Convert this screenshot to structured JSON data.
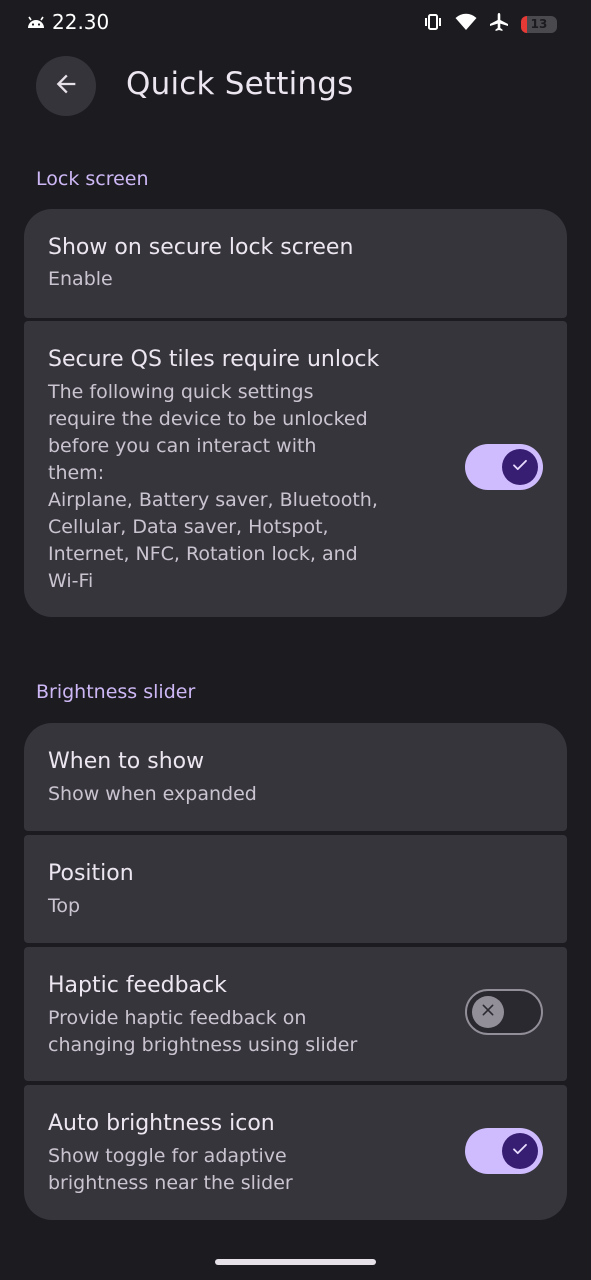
{
  "status_bar": {
    "time": "22.30",
    "battery_level": "13",
    "icons": [
      "android-icon",
      "vibrate-icon",
      "wifi-icon",
      "airplane-icon",
      "battery-icon"
    ]
  },
  "header": {
    "title": "Quick Settings",
    "back_icon": "arrow-back-icon"
  },
  "sections": {
    "lock_screen": {
      "label": "Lock screen",
      "items": [
        {
          "title": "Show on secure lock screen",
          "subtitle": "Enable"
        },
        {
          "title": "Secure QS tiles require unlock",
          "subtitle_lines": [
            "The following quick settings",
            "require the device to be unlocked",
            "before you can interact with",
            "them:",
            "Airplane, Battery saver, Bluetooth,",
            "Cellular, Data saver, Hotspot,",
            "Internet, NFC, Rotation lock, and",
            "Wi-Fi"
          ],
          "toggle": "on"
        }
      ]
    },
    "brightness_slider": {
      "label": "Brightness slider",
      "items": [
        {
          "title": "When to show",
          "subtitle": "Show when expanded"
        },
        {
          "title": "Position",
          "subtitle": "Top"
        },
        {
          "title": "Haptic feedback",
          "subtitle_lines": [
            "Provide haptic feedback on",
            "changing brightness using slider"
          ],
          "toggle": "off"
        },
        {
          "title": "Auto brightness icon",
          "subtitle_lines": [
            "Show toggle for adaptive",
            "brightness near the slider"
          ],
          "toggle": "on"
        }
      ]
    }
  },
  "colors": {
    "background": "#1c1b20",
    "card": "#37353c",
    "accent": "#cfbcff",
    "section_label": "#cdb8f5",
    "battery_low": "#e53935"
  }
}
